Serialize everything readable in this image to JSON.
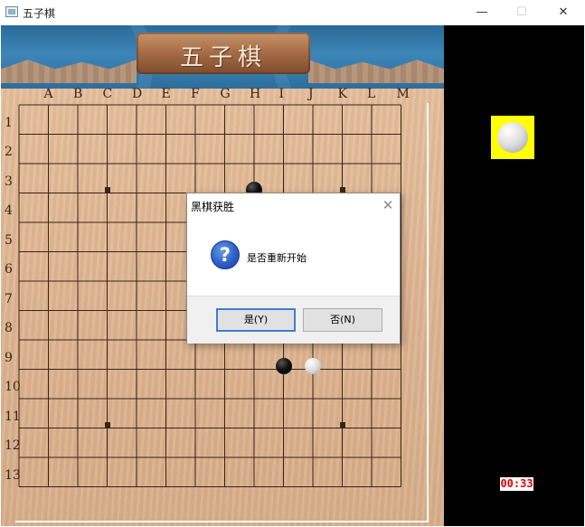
{
  "window": {
    "title": "五子棋",
    "controls": {
      "minimize": "—",
      "maximize": "☐",
      "close": "✕"
    }
  },
  "banner": {
    "title": "五子棋"
  },
  "board": {
    "columns": [
      "A",
      "B",
      "C",
      "D",
      "E",
      "F",
      "G",
      "H",
      "I",
      "J",
      "K",
      "L",
      "M"
    ],
    "rows": [
      "1",
      "2",
      "3",
      "4",
      "5",
      "6",
      "7",
      "8",
      "9",
      "10",
      "11",
      "12",
      "13"
    ],
    "star_points": [
      "C3",
      "K3",
      "C11",
      "K11"
    ],
    "stones": [
      {
        "point": "H3",
        "color": "black"
      },
      {
        "point": "I9",
        "color": "black"
      },
      {
        "point": "J9",
        "color": "white"
      }
    ],
    "colors": {
      "wood": "#deb592",
      "line": "#3a2414"
    }
  },
  "side_panel": {
    "current_turn": "white",
    "indicator_color": "#ffff00",
    "timer": "00:33",
    "timer_color": "#e00000"
  },
  "dialog": {
    "title": "黑棋获胜",
    "close_icon": "✕",
    "icon": "question-icon",
    "message": "是否重新开始",
    "yes_label": "是(Y)",
    "no_label": "否(N)",
    "accent": "#3c7fd1"
  }
}
